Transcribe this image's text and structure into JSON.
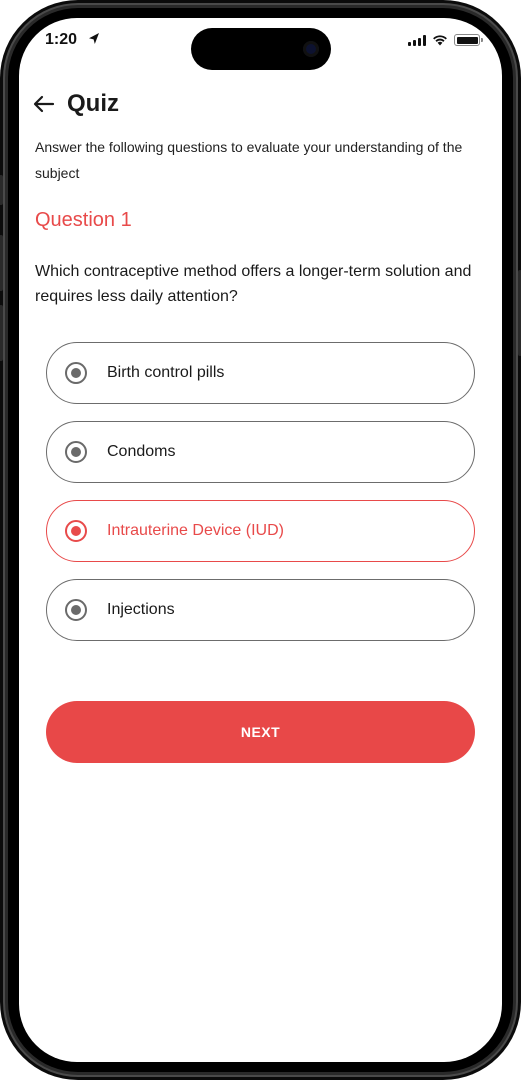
{
  "status_bar": {
    "time": "1:20"
  },
  "header": {
    "title": "Quiz",
    "subtitle": "Answer the following questions to evaluate your understanding of the subject"
  },
  "question": {
    "label": "Question 1",
    "text": "Which contraceptive method offers a longer-term solution and requires less daily attention?"
  },
  "options": [
    {
      "label": "Birth control pills",
      "selected": false
    },
    {
      "label": "Condoms",
      "selected": false
    },
    {
      "label": "Intrauterine Device (IUD)",
      "selected": true
    },
    {
      "label": "Injections",
      "selected": false
    }
  ],
  "next_button": {
    "label": "NEXT"
  },
  "colors": {
    "accent": "#e84a4a",
    "text": "#1a1a1a",
    "option_border": "#6c6c6c"
  },
  "icons": {
    "back": "arrow-left-icon",
    "location": "location-arrow-icon",
    "signal": "cellular-signal-icon",
    "wifi": "wifi-icon",
    "battery": "battery-icon"
  }
}
